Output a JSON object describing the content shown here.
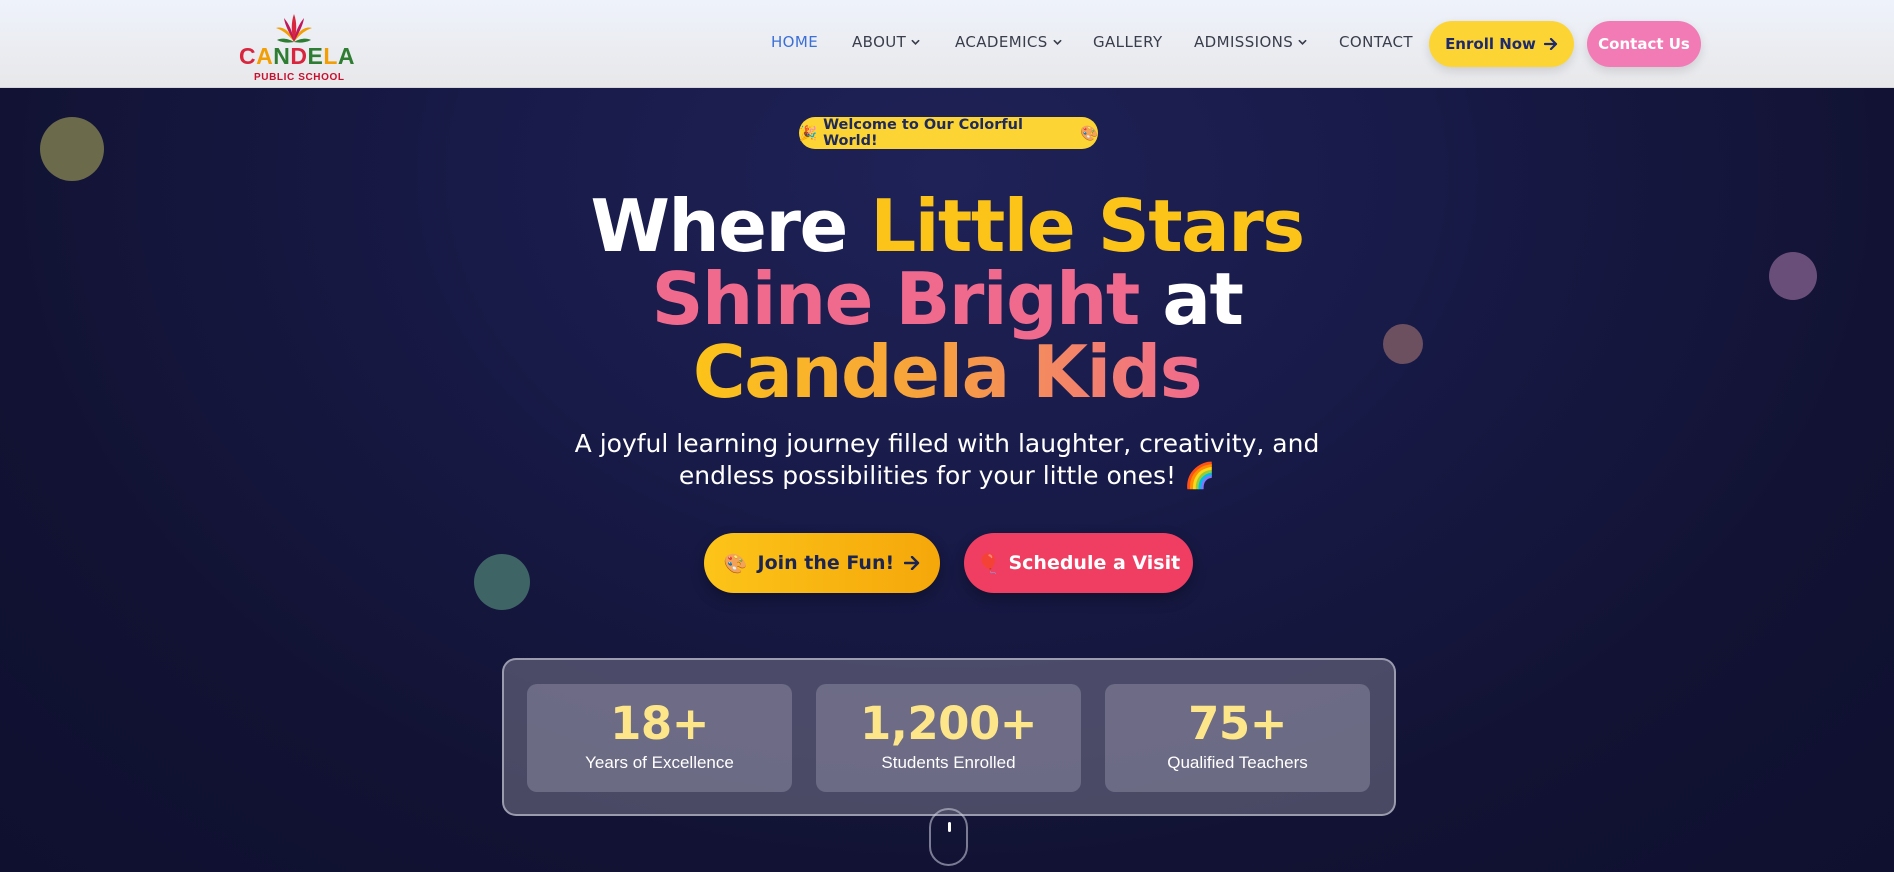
{
  "header": {
    "logo": {
      "name_letters": [
        "C",
        "A",
        "N",
        "D",
        "E",
        "L",
        "A"
      ],
      "name_colors": [
        "#d7263d",
        "#f29f05",
        "#2e7d32",
        "#d7263d",
        "#2e7d32",
        "#f29f05",
        "#2e7d32"
      ],
      "subtitle": "PUBLIC SCHOOL"
    },
    "nav": [
      {
        "label": "HOME",
        "active": true,
        "dropdown": false
      },
      {
        "label": "ABOUT",
        "active": false,
        "dropdown": true
      },
      {
        "label": "ACADEMICS",
        "active": false,
        "dropdown": true
      },
      {
        "label": "GALLERY",
        "active": false,
        "dropdown": false
      },
      {
        "label": "ADMISSIONS",
        "active": false,
        "dropdown": true
      },
      {
        "label": "CONTACT",
        "active": false,
        "dropdown": false
      }
    ],
    "enroll_label": "Enroll Now",
    "enroll_icon": "arrow-right-icon",
    "contact_label": "Contact Us"
  },
  "hero": {
    "badge": {
      "icon_left": "🎉",
      "text": "Welcome to Our Colorful World!",
      "icon_right": "🎨"
    },
    "headline": {
      "line1_a": "Where ",
      "line1_b": "Little Stars",
      "line2_a": "Shine Bright",
      "line2_b": " at",
      "line3": "Candela Kids"
    },
    "subtitle_line1": "A joyful learning journey filled with laughter, creativity, and",
    "subtitle_line2": "endless possibilities for your little ones! 🌈",
    "cta_primary": {
      "icon": "🎨",
      "label": "Join the Fun!",
      "arrow": "arrow-right-icon"
    },
    "cta_secondary": {
      "icon": "🎈",
      "label": "Schedule a Visit"
    }
  },
  "stats": [
    {
      "value": "18+",
      "label": "Years of Excellence"
    },
    {
      "value": "1,200+",
      "label": "Students Enrolled"
    },
    {
      "value": "75+",
      "label": "Qualified Teachers"
    }
  ],
  "colors": {
    "accent_yellow": "#fcd535",
    "accent_pink": "#f27bb5",
    "accent_red": "#f03e63",
    "nav_active": "#3b6fd8",
    "hero_bg": "#181a48"
  }
}
